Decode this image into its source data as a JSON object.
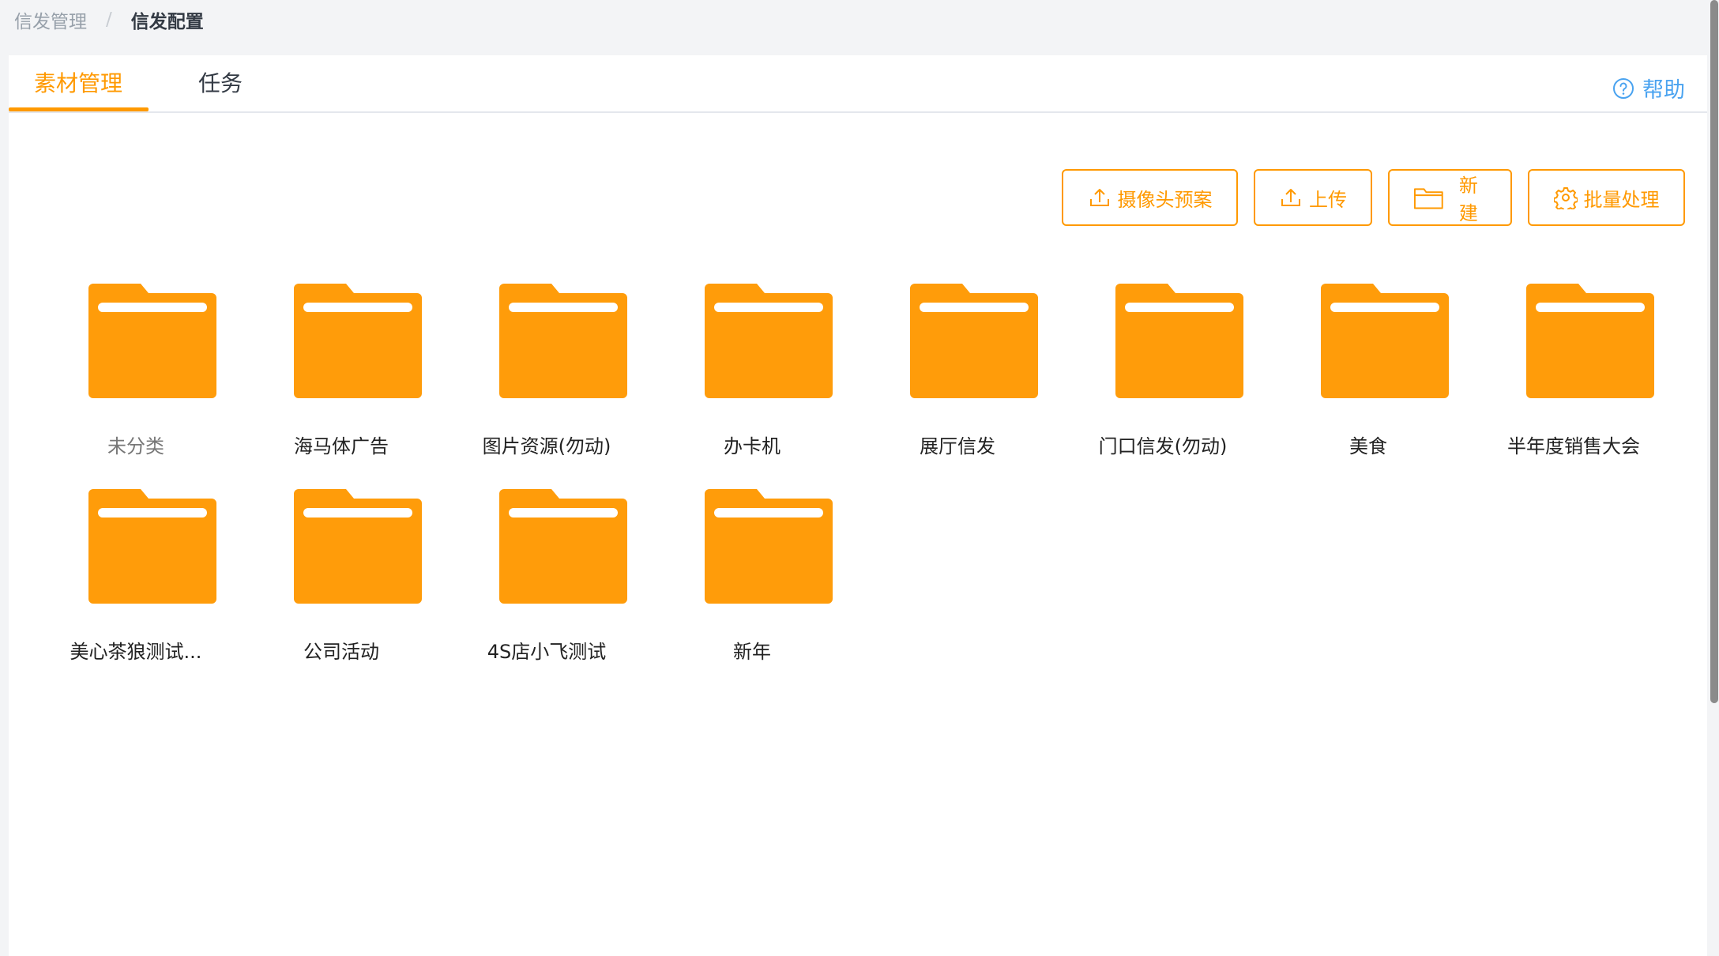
{
  "breadcrumb": {
    "items": [
      "信发管理",
      "信发配置"
    ],
    "separator": "/"
  },
  "tabs": [
    {
      "label": "素材管理",
      "active": true
    },
    {
      "label": "任务",
      "active": false
    }
  ],
  "help": {
    "label": "帮助",
    "icon": "question-circle-icon"
  },
  "toolbar": {
    "camera_plan_label": "摄像头预案",
    "upload_label": "上传",
    "new_label": "新建",
    "batch_label": "批量处理"
  },
  "folders": [
    {
      "name": "未分类"
    },
    {
      "name": "海马体广告"
    },
    {
      "name": "图片资源(勿动)"
    },
    {
      "name": "办卡机"
    },
    {
      "name": "展厅信发"
    },
    {
      "name": "门口信发(勿动)"
    },
    {
      "name": "美食"
    },
    {
      "name": "半年度销售大会"
    },
    {
      "name": "美心茶狼测试..."
    },
    {
      "name": "公司活动"
    },
    {
      "name": "4S店小飞测试"
    },
    {
      "name": "新年"
    }
  ],
  "colors": {
    "accent": "#ff9900",
    "help": "#4aa3f0",
    "folder": "#ff9c0a"
  }
}
